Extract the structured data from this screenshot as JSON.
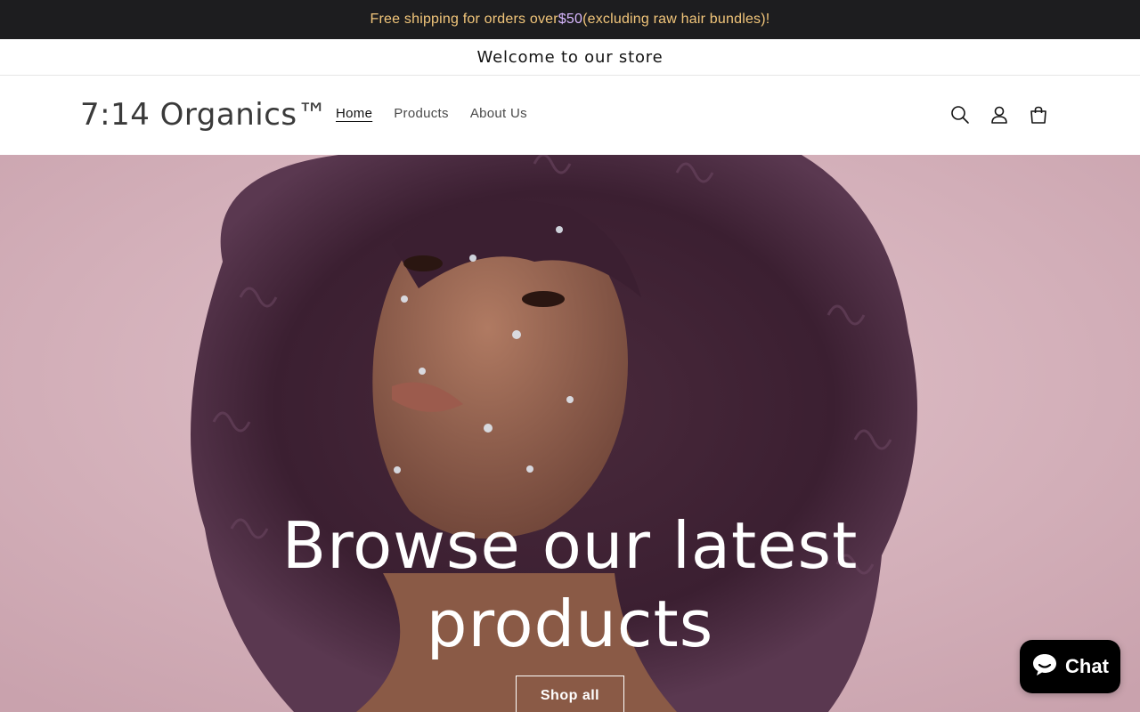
{
  "announcement": {
    "text_before": "Free shipping for orders over ",
    "price": "$50",
    "text_after": " (excluding raw hair bundles)!"
  },
  "welcome": {
    "text": "Welcome to our store"
  },
  "header": {
    "logo": "7:14 Organics™",
    "nav": [
      {
        "label": "Home",
        "active": true
      },
      {
        "label": "Products",
        "active": false
      },
      {
        "label": "About Us",
        "active": false
      }
    ],
    "icons": [
      "search-icon",
      "account-icon",
      "cart-icon"
    ]
  },
  "hero": {
    "title_line1": "Browse our latest",
    "title_line2": "products",
    "button_label": "Shop all"
  },
  "chat": {
    "label": "Chat",
    "icon": "chat-bubble-icon"
  },
  "colors": {
    "topbar_bg": "#1d1d1f",
    "topbar_text": "#f1c57a",
    "hero_bg": "#d7b3bd",
    "chat_bg": "#000000"
  }
}
